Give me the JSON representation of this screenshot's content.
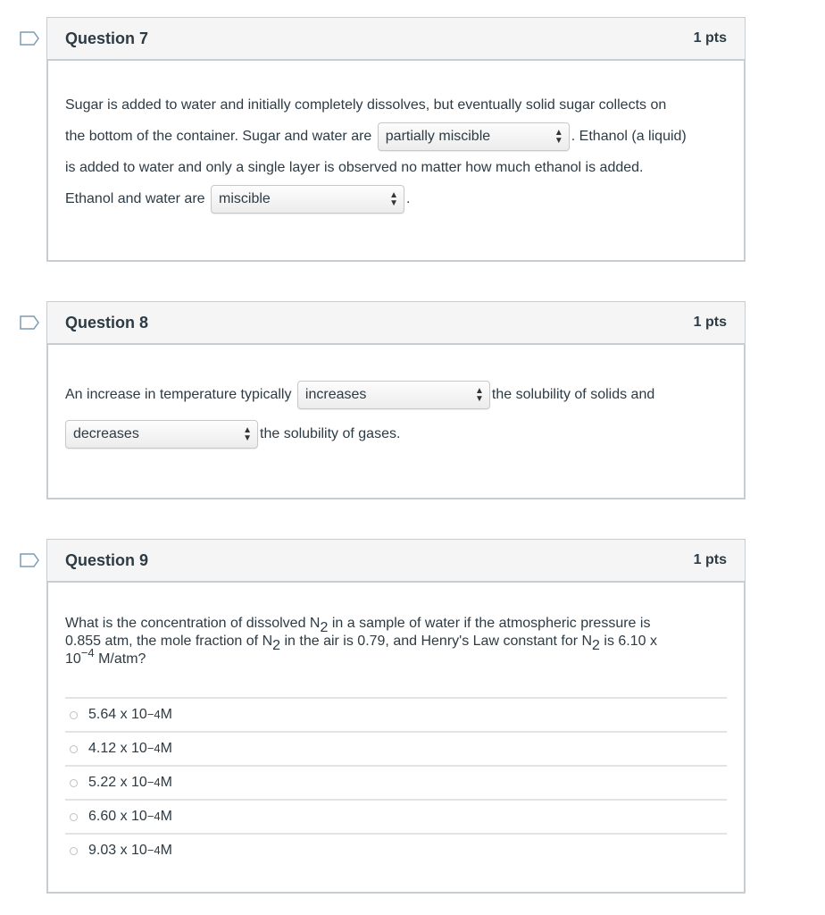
{
  "questions": [
    {
      "title": "Question 7",
      "points": "1 pts",
      "text": {
        "p1": "Sugar is added to water and initially completely dissolves, but eventually solid sugar collects on",
        "p2": "the bottom of the container. Sugar and water are",
        "p3": ". Ethanol (a liquid)",
        "p4": "is added to water and only a single layer is observed no matter how much ethanol is added.",
        "p5": "Ethanol and water are",
        "p6": "."
      },
      "dropdowns": [
        {
          "selected": "partially miscible"
        },
        {
          "selected": "miscible"
        }
      ]
    },
    {
      "title": "Question 8",
      "points": "1 pts",
      "text": {
        "p1": "An increase in temperature typically",
        "p2": "the solubility of solids and",
        "p3": "the solubility of gases."
      },
      "dropdowns": [
        {
          "selected": "increases"
        },
        {
          "selected": "decreases"
        }
      ]
    },
    {
      "title": "Question 9",
      "points": "1 pts",
      "text": {
        "a": "What is the concentration of dissolved N",
        "sub1": "2",
        "b": " in a sample of water if the atmospheric pressure is",
        "c": "0.855 atm, the mole fraction of N",
        "sub2": "2",
        "d": " in the air is 0.79, and Henry's Law constant for N",
        "sub3": "2",
        "e": " is 6.10 x",
        "f": "10",
        "sup": "−4",
        "g": " M/atm?"
      },
      "answers": [
        {
          "mantissa": "5.64 x 10",
          "exp": "−4",
          "unit": " M"
        },
        {
          "mantissa": "4.12 x 10",
          "exp": "−4",
          "unit": " M"
        },
        {
          "mantissa": "5.22 x 10",
          "exp": "−4",
          "unit": " M"
        },
        {
          "mantissa": "6.60 x 10",
          "exp": "−4",
          "unit": " M"
        },
        {
          "mantissa": "9.03 x 10",
          "exp": "−4",
          "unit": " M"
        }
      ]
    }
  ],
  "icons": {
    "flag": "flag-bookmark-icon",
    "select_arrows": "▲▼"
  }
}
